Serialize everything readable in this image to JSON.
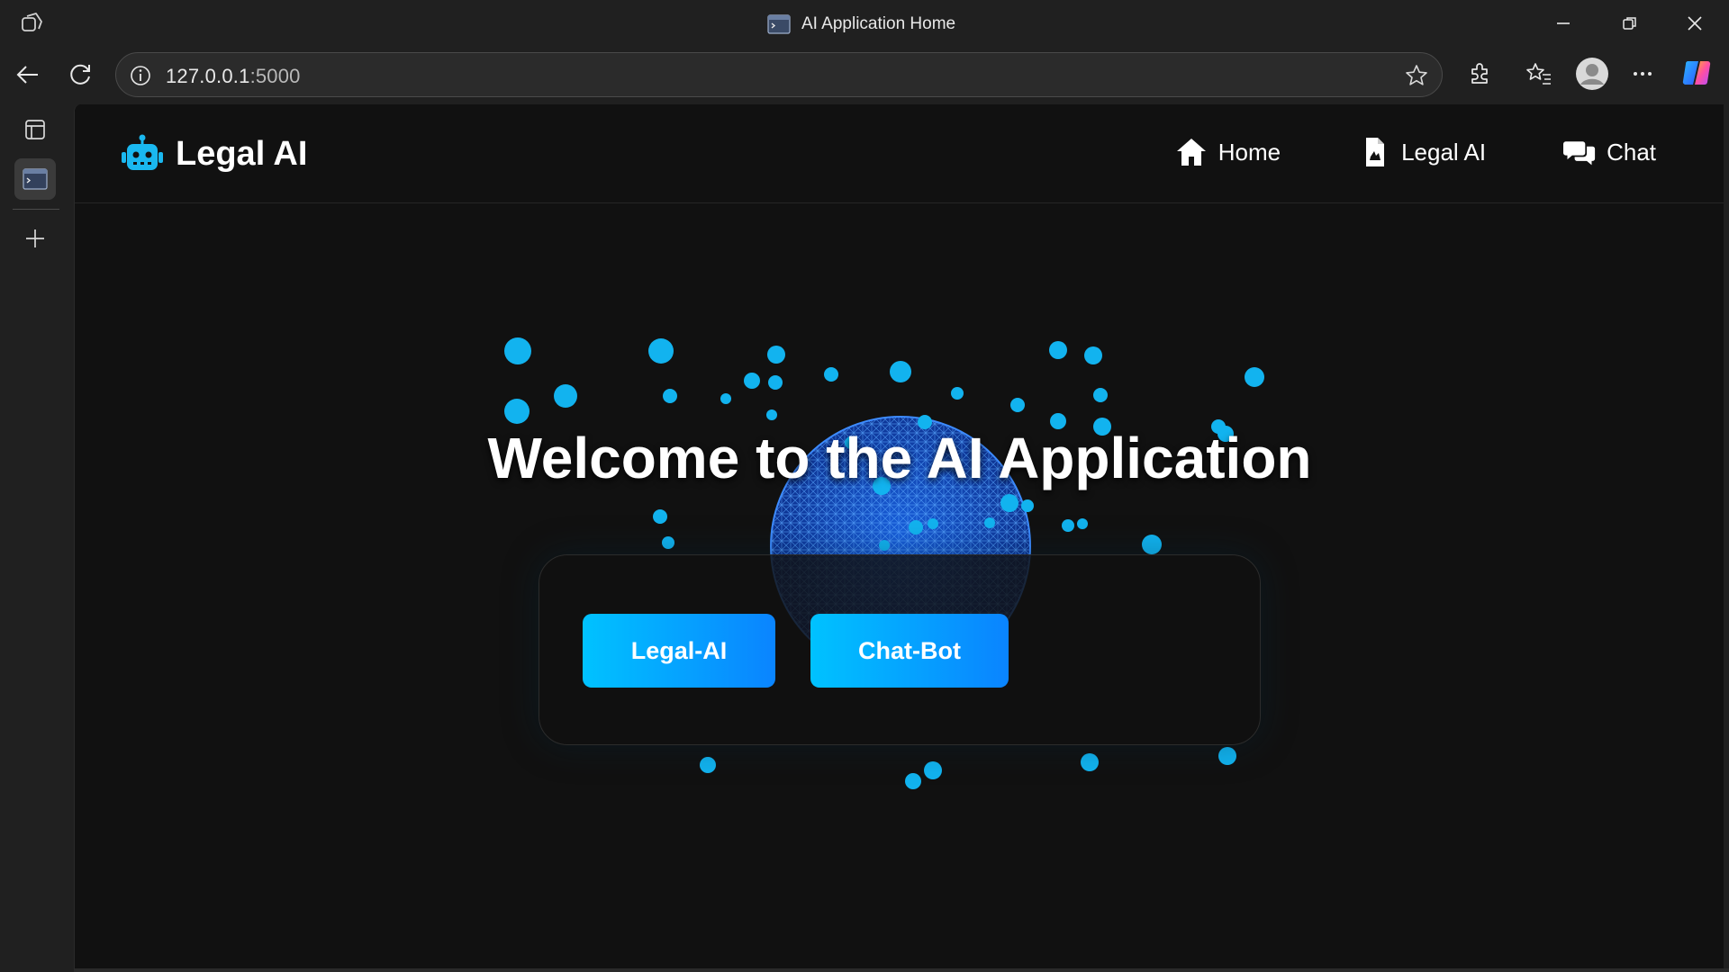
{
  "browser": {
    "window_title": "AI Application Home",
    "url_host": "127.0.0.1",
    "url_port": ":5000"
  },
  "site": {
    "brand_name": "Legal AI",
    "nav": [
      {
        "label": "Home",
        "icon": "home-icon"
      },
      {
        "label": "Legal AI",
        "icon": "document-icon"
      },
      {
        "label": "Chat",
        "icon": "chat-bubbles-icon"
      }
    ]
  },
  "hero": {
    "title": "Welcome to the AI Application",
    "buttons": [
      {
        "label": "Legal-AI"
      },
      {
        "label": "Chat-Bot"
      }
    ]
  },
  "colors": {
    "accent": "#00c2ff",
    "accent_end": "#0a84ff",
    "page_bg": "#111111",
    "browser_chrome": "#202020"
  }
}
